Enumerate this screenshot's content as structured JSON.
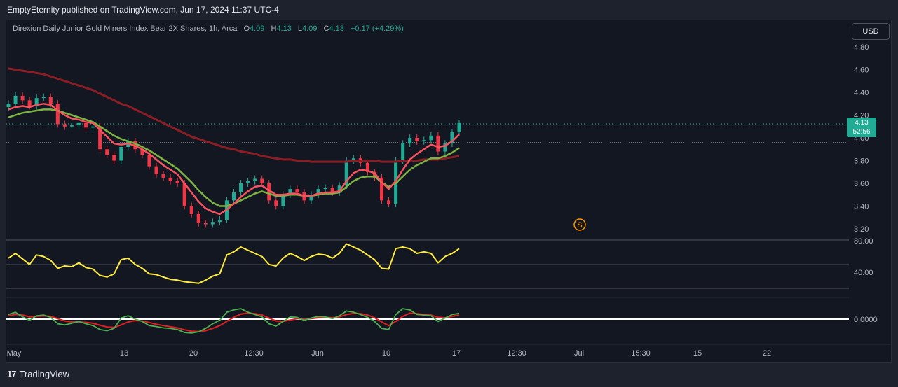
{
  "header": {
    "publisher_line": "EmptyEternity published on TradingView.com, Jun 17, 2024 11:37 UTC-4"
  },
  "legend": {
    "symbol": "Direxion Daily Junior Gold Miners Index Bear 2X Shares, 1h, Arca",
    "o_label": "O",
    "o_value": "4.09",
    "h_label": "H",
    "h_value": "4.13",
    "l_label": "L",
    "l_value": "4.09",
    "c_label": "C",
    "c_value": "4.13",
    "change": "+0.17 (+4.29%)"
  },
  "currency_button": "USD",
  "price_tag": {
    "price": "4.13",
    "countdown": "52:56"
  },
  "footer": {
    "brand": "TradingView"
  },
  "colors": {
    "up": "#22ab94",
    "down": "#f23645",
    "ema_red": "#f7525f",
    "ema_green": "#7cb342",
    "sma_long": "#8b1e25",
    "rsi": "#ffeb3b",
    "osc_green": "#4caf50",
    "osc_red": "#e02020"
  },
  "chart_data": {
    "type": "line",
    "price_axis": {
      "ticks": [
        "4.80",
        "4.60",
        "4.40",
        "4.20",
        "4.00",
        "3.80",
        "3.60",
        "3.40",
        "3.20"
      ],
      "range": [
        3.16,
        4.9
      ]
    },
    "time_axis": {
      "ticks": [
        "May",
        "13",
        "20",
        "12:30",
        "Jun",
        "10",
        "17",
        "12:30",
        "Jul",
        "15:30",
        "15",
        "22"
      ]
    },
    "price_series": {
      "x": [
        0,
        1,
        2,
        3,
        4,
        5,
        6,
        7,
        8,
        9,
        10,
        11,
        12,
        13,
        14,
        15,
        16,
        17,
        18,
        19,
        20,
        21,
        22,
        23,
        24,
        25,
        26,
        27,
        28,
        29,
        30,
        31,
        32,
        33,
        34,
        35,
        36,
        37,
        38,
        39,
        40,
        41,
        42,
        43,
        44,
        45,
        46,
        47,
        48,
        49,
        50,
        51,
        52,
        53,
        54,
        55,
        56,
        57,
        58,
        59,
        60,
        61,
        62,
        63,
        64
      ],
      "close": [
        4.3,
        4.37,
        4.33,
        4.28,
        4.35,
        4.36,
        4.3,
        4.12,
        4.1,
        4.11,
        4.13,
        4.09,
        4.1,
        3.9,
        3.85,
        3.8,
        3.92,
        3.97,
        3.9,
        3.85,
        3.75,
        3.68,
        3.65,
        3.62,
        3.6,
        3.4,
        3.33,
        3.25,
        3.24,
        3.26,
        3.28,
        3.45,
        3.52,
        3.6,
        3.62,
        3.64,
        3.6,
        3.45,
        3.4,
        3.5,
        3.55,
        3.52,
        3.45,
        3.5,
        3.55,
        3.56,
        3.52,
        3.58,
        3.8,
        3.82,
        3.78,
        3.7,
        3.65,
        3.45,
        3.42,
        3.8,
        3.95,
        4.0,
        3.97,
        3.98,
        4.02,
        3.88,
        3.95,
        4.05,
        4.13
      ],
      "ema_fast": [
        4.25,
        4.27,
        4.28,
        4.27,
        4.29,
        4.3,
        4.29,
        4.24,
        4.2,
        4.17,
        4.16,
        4.14,
        4.13,
        4.07,
        4.01,
        3.95,
        3.94,
        3.95,
        3.93,
        3.9,
        3.86,
        3.81,
        3.76,
        3.72,
        3.68,
        3.6,
        3.52,
        3.44,
        3.38,
        3.35,
        3.33,
        3.37,
        3.42,
        3.48,
        3.53,
        3.57,
        3.58,
        3.54,
        3.5,
        3.5,
        3.51,
        3.51,
        3.49,
        3.49,
        3.51,
        3.52,
        3.52,
        3.53,
        3.62,
        3.69,
        3.72,
        3.71,
        3.69,
        3.61,
        3.55,
        3.62,
        3.72,
        3.81,
        3.86,
        3.9,
        3.94,
        3.92,
        3.93,
        3.97,
        4.03
      ],
      "ema_slow": [
        4.18,
        4.2,
        4.22,
        4.23,
        4.24,
        4.25,
        4.25,
        4.24,
        4.22,
        4.2,
        4.18,
        4.16,
        4.14,
        4.1,
        4.06,
        4.02,
        3.99,
        3.97,
        3.95,
        3.92,
        3.89,
        3.85,
        3.81,
        3.77,
        3.73,
        3.67,
        3.61,
        3.54,
        3.48,
        3.43,
        3.4,
        3.4,
        3.42,
        3.45,
        3.48,
        3.51,
        3.53,
        3.51,
        3.49,
        3.49,
        3.5,
        3.5,
        3.49,
        3.49,
        3.5,
        3.51,
        3.51,
        3.52,
        3.57,
        3.62,
        3.65,
        3.66,
        3.66,
        3.61,
        3.57,
        3.6,
        3.66,
        3.72,
        3.76,
        3.79,
        3.82,
        3.82,
        3.84,
        3.87,
        3.91
      ],
      "sma_long": [
        4.61,
        4.6,
        4.59,
        4.58,
        4.57,
        4.56,
        4.54,
        4.52,
        4.5,
        4.48,
        4.46,
        4.44,
        4.42,
        4.39,
        4.36,
        4.33,
        4.3,
        4.28,
        4.25,
        4.22,
        4.19,
        4.16,
        4.13,
        4.1,
        4.07,
        4.04,
        4.01,
        3.99,
        3.97,
        3.95,
        3.93,
        3.91,
        3.9,
        3.88,
        3.87,
        3.86,
        3.84,
        3.83,
        3.82,
        3.81,
        3.81,
        3.8,
        3.8,
        3.79,
        3.79,
        3.79,
        3.79,
        3.79,
        3.79,
        3.8,
        3.8,
        3.8,
        3.8,
        3.79,
        3.79,
        3.79,
        3.8,
        3.8,
        3.8,
        3.81,
        3.81,
        3.81,
        3.82,
        3.83,
        3.84
      ]
    },
    "rsi_panel": {
      "ticks": [
        "80.00",
        "40.00"
      ],
      "range": [
        25,
        85
      ],
      "values": [
        58,
        64,
        57,
        50,
        62,
        60,
        55,
        45,
        48,
        47,
        52,
        46,
        44,
        36,
        34,
        38,
        56,
        58,
        50,
        45,
        38,
        37,
        34,
        31,
        30,
        28,
        27,
        26,
        30,
        35,
        38,
        62,
        66,
        72,
        68,
        64,
        60,
        50,
        48,
        58,
        64,
        60,
        55,
        60,
        63,
        62,
        58,
        64,
        76,
        72,
        68,
        62,
        56,
        45,
        44,
        70,
        72,
        70,
        64,
        66,
        64,
        52,
        60,
        64,
        70
      ]
    },
    "osc_panel": {
      "ticks": [
        "0.0000"
      ],
      "zero": 0,
      "fast": [
        0.02,
        0.03,
        0.01,
        -0.005,
        0.015,
        0.018,
        0.008,
        -0.02,
        -0.025,
        -0.018,
        -0.01,
        -0.02,
        -0.028,
        -0.045,
        -0.05,
        -0.04,
        0.005,
        0.015,
        0.0,
        -0.01,
        -0.028,
        -0.032,
        -0.038,
        -0.04,
        -0.045,
        -0.058,
        -0.06,
        -0.055,
        -0.04,
        -0.02,
        -0.005,
        0.03,
        0.04,
        0.045,
        0.03,
        0.02,
        0.01,
        -0.02,
        -0.03,
        -0.01,
        0.01,
        0.008,
        -0.005,
        0.005,
        0.012,
        0.01,
        0.002,
        0.015,
        0.035,
        0.03,
        0.02,
        0.008,
        -0.01,
        -0.04,
        -0.045,
        0.02,
        0.045,
        0.04,
        0.02,
        0.018,
        0.015,
        -0.01,
        0.005,
        0.02,
        0.025
      ],
      "signal": [
        0.015,
        0.02,
        0.018,
        0.01,
        0.012,
        0.014,
        0.012,
        0.002,
        -0.008,
        -0.012,
        -0.012,
        -0.014,
        -0.018,
        -0.026,
        -0.034,
        -0.036,
        -0.025,
        -0.012,
        -0.006,
        -0.008,
        -0.015,
        -0.022,
        -0.028,
        -0.033,
        -0.038,
        -0.046,
        -0.052,
        -0.054,
        -0.05,
        -0.04,
        -0.028,
        -0.01,
        0.008,
        0.022,
        0.026,
        0.024,
        0.018,
        0.005,
        -0.008,
        -0.01,
        -0.004,
        0.002,
        0.0,
        0.002,
        0.006,
        0.008,
        0.006,
        0.01,
        0.02,
        0.025,
        0.024,
        0.018,
        0.006,
        -0.012,
        -0.028,
        -0.01,
        0.012,
        0.026,
        0.024,
        0.02,
        0.018,
        0.008,
        0.006,
        0.012,
        0.018
      ]
    }
  }
}
